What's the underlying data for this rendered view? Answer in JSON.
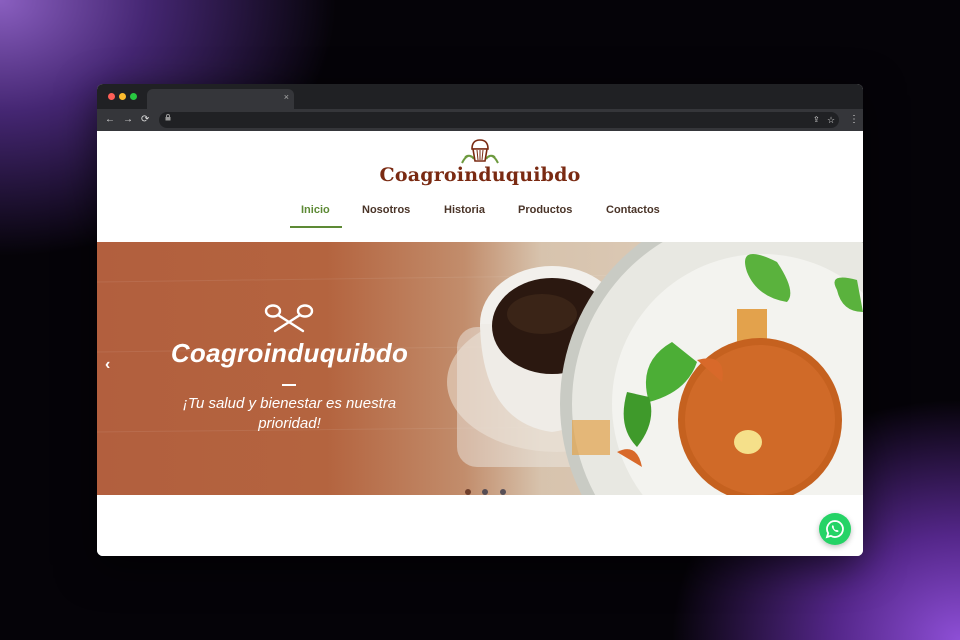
{
  "browser": {
    "tab_close": "×",
    "back_icon": "←",
    "forward_icon": "→",
    "reload_icon": "⟳",
    "share_icon": "⇪",
    "star_icon": "☆",
    "menu_icon": "⋮"
  },
  "site": {
    "logo_text": "Coagroinduquibdo",
    "nav": [
      {
        "label": "Inicio",
        "active": true
      },
      {
        "label": "Nosotros"
      },
      {
        "label": "Historia"
      },
      {
        "label": "Productos"
      },
      {
        "label": "Contactos"
      }
    ]
  },
  "hero": {
    "title": "Coagroinduquibdo",
    "subtitle_line1": "¡Tu salud y bienestar es nuestra",
    "subtitle_line2": "prioridad!",
    "prev_icon": "‹",
    "slide_count": 3,
    "active_slide": 1
  },
  "colors": {
    "brand": "#7a2a12",
    "accent": "#5d8a35",
    "whatsapp": "#25d366"
  }
}
